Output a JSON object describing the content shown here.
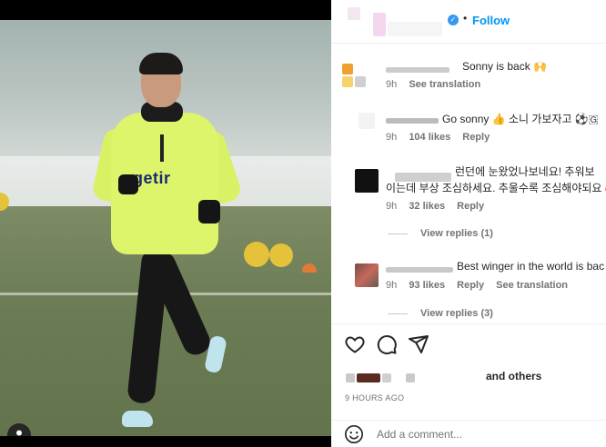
{
  "post": {
    "image_alt": "Player in neon training top running on a snowy pitch",
    "sponsor_text": "getir"
  },
  "header": {
    "follow_label": "Follow",
    "dot": "•"
  },
  "comments": [
    {
      "text": "Sonny is back 🙌",
      "time": "9h",
      "likes": "",
      "reply_label": "",
      "translation_label": "See translation"
    },
    {
      "text": "Go sonny 👍 소니 가보자고 ⚽🇬",
      "time": "9h",
      "likes": "104 likes",
      "reply_label": "Reply",
      "translation_label": ""
    },
    {
      "text_line1": "런던에 눈왔었나보네요! 추워보",
      "text_line2": "이는데 부상 조심하세요. 추울수록 조심해야되요 🥰 응원",
      "time": "9h",
      "likes": "32 likes",
      "reply_label": "Reply",
      "view_replies": "View replies (1)"
    },
    {
      "text": "Best winger in the world is bac",
      "time": "9h",
      "likes": "93 likes",
      "reply_label": "Reply",
      "translation_label": "See translation",
      "view_replies": "View replies (3)"
    }
  ],
  "actions": {
    "liked_by_suffix": "and others",
    "time_ago": "9 HOURS AGO"
  },
  "composer": {
    "placeholder": "Add a comment..."
  },
  "colors": {
    "follow_blue": "#0095f6",
    "verified_blue": "#3897f0",
    "jersey": "#ddf56a"
  },
  "icons": [
    "heart-icon",
    "comment-icon",
    "share-icon",
    "emoji-icon",
    "user-tag-icon",
    "verified-icon"
  ]
}
